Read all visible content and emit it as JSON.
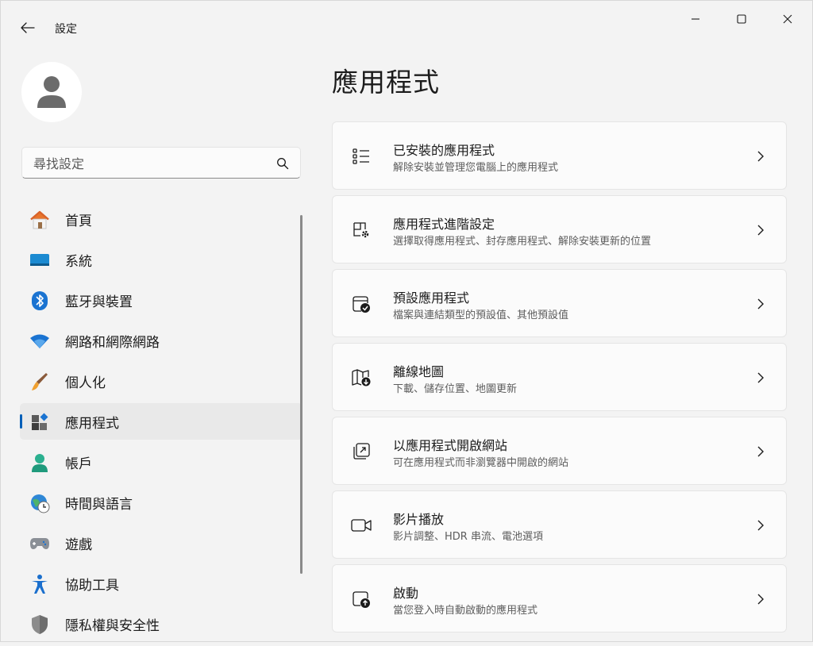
{
  "window": {
    "title": "設定",
    "controls": [
      "minimize",
      "maximize",
      "close"
    ]
  },
  "sidebar": {
    "search": {
      "placeholder": "尋找設定",
      "value": ""
    },
    "items": [
      {
        "label": "首頁",
        "icon": "home-icon",
        "active": false
      },
      {
        "label": "系統",
        "icon": "system-icon",
        "active": false
      },
      {
        "label": "藍牙與裝置",
        "icon": "bluetooth-icon",
        "active": false
      },
      {
        "label": "網路和網際網路",
        "icon": "wifi-icon",
        "active": false
      },
      {
        "label": "個人化",
        "icon": "brush-icon",
        "active": false
      },
      {
        "label": "應用程式",
        "icon": "apps-icon",
        "active": true
      },
      {
        "label": "帳戶",
        "icon": "account-icon",
        "active": false
      },
      {
        "label": "時間與語言",
        "icon": "time-language-icon",
        "active": false
      },
      {
        "label": "遊戲",
        "icon": "gamepad-icon",
        "active": false
      },
      {
        "label": "協助工具",
        "icon": "accessibility-icon",
        "active": false
      },
      {
        "label": "隱私權與安全性",
        "icon": "shield-icon",
        "active": false
      }
    ]
  },
  "main": {
    "title": "應用程式",
    "cards": [
      {
        "title": "已安裝的應用程式",
        "desc": "解除安裝並管理您電腦上的應用程式",
        "icon": "list-icon"
      },
      {
        "title": "應用程式進階設定",
        "desc": "選擇取得應用程式、封存應用程式、解除安裝更新的位置",
        "icon": "app-settings-icon"
      },
      {
        "title": "預設應用程式",
        "desc": "檔案與連結類型的預設值、其他預設值",
        "icon": "default-apps-icon"
      },
      {
        "title": "離線地圖",
        "desc": "下載、儲存位置、地圖更新",
        "icon": "map-icon"
      },
      {
        "title": "以應用程式開啟網站",
        "desc": "可在應用程式而非瀏覽器中開啟的網站",
        "icon": "open-external-icon"
      },
      {
        "title": "影片播放",
        "desc": "影片調整、HDR 串流、電池選項",
        "icon": "video-icon"
      },
      {
        "title": "啟動",
        "desc": "當您登入時自動啟動的應用程式",
        "icon": "startup-icon"
      }
    ]
  },
  "colors": {
    "accent": "#005fb8",
    "background": "#f3f3f3",
    "card": "#fbfbfb"
  }
}
